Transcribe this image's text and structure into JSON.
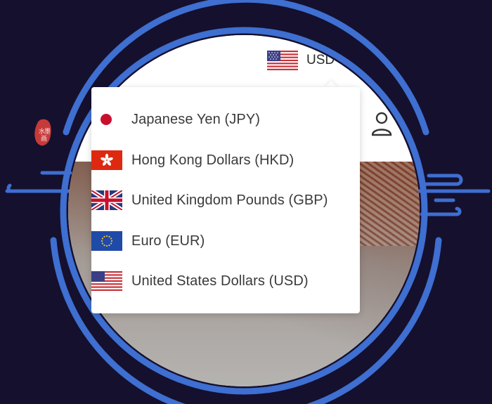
{
  "header": {
    "selected_currency": {
      "code": "USD",
      "flag_icon": "us-flag-icon"
    }
  },
  "currency_menu": {
    "items": [
      {
        "label": "Japanese Yen (JPY)",
        "flag_icon": "japan-flag-icon"
      },
      {
        "label": "Hong Kong Dollars (HKD)",
        "flag_icon": "hong-kong-flag-icon"
      },
      {
        "label": "United Kingdom Pounds (GBP)",
        "flag_icon": "uk-flag-icon"
      },
      {
        "label": "Euro (EUR)",
        "flag_icon": "eu-flag-icon"
      },
      {
        "label": "United States Dollars (USD)",
        "flag_icon": "us-flag-icon"
      }
    ]
  },
  "colors": {
    "background": "#15102e",
    "ring": "#3e6fd1",
    "menu_text": "#3a3a3a"
  },
  "decor": {
    "seal_icon": "red-seal-icon",
    "cloud_icon": "cloud-swirl-icon"
  }
}
